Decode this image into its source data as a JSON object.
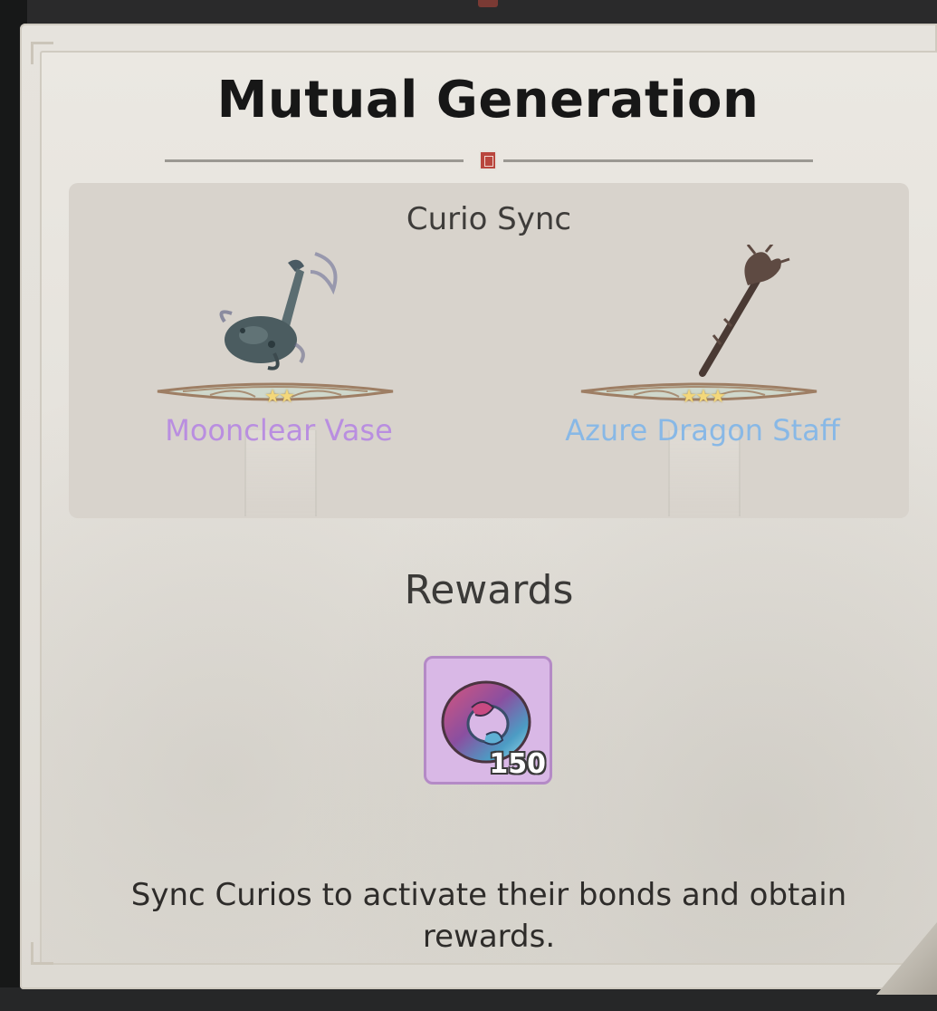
{
  "panel": {
    "title": "Mutual Generation"
  },
  "curio_sync": {
    "heading": "Curio Sync",
    "curios": [
      {
        "name": "Moonclear Vase",
        "stars": 2,
        "stars_display": "★★",
        "name_color": "#b98ee0"
      },
      {
        "name": "Azure Dragon Staff",
        "stars": 3,
        "stars_display": "★★★",
        "name_color": "#88b8e6"
      }
    ]
  },
  "rewards": {
    "heading": "Rewards",
    "items": [
      {
        "icon": "ring-icon",
        "count": "150"
      }
    ]
  },
  "hint": "Sync Curios to activate their bonds and obtain rewards.",
  "colors": {
    "panel_bg": "#e6e3dd",
    "reward_frame": "#d9b8e6"
  }
}
